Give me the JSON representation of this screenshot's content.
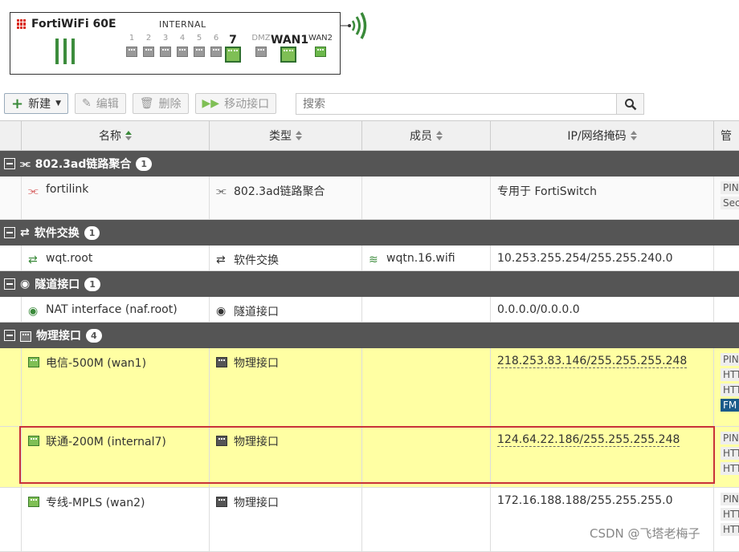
{
  "device": {
    "name": "FortiWiFi 60E",
    "internal_label": "INTERNAL",
    "ports": [
      "1",
      "2",
      "3",
      "4",
      "5",
      "6",
      "7"
    ],
    "dmz": "DMZ",
    "wan1": "WAN1",
    "wan2": "WAN2"
  },
  "toolbar": {
    "new_label": "新建",
    "edit_label": "编辑",
    "delete_label": "删除",
    "move_label": "移动接口"
  },
  "search": {
    "placeholder": "搜索"
  },
  "columns": {
    "name": "名称",
    "type": "类型",
    "members": "成员",
    "ip": "IP/网络掩码",
    "admin": "管"
  },
  "groups": [
    {
      "label": "802.3ad链路聚合",
      "count": "1"
    },
    {
      "label": "软件交换",
      "count": "1"
    },
    {
      "label": "隧道接口",
      "count": "1"
    },
    {
      "label": "物理接口",
      "count": "4"
    }
  ],
  "rows": [
    {
      "name": "fortilink",
      "type": "802.3ad链路聚合",
      "member": "",
      "ip": "专用于 FortiSwitch",
      "access": [
        "PIN",
        "Sec"
      ]
    },
    {
      "name": "wqt.root",
      "type": "软件交换",
      "member": "wqtn.16.wifi",
      "ip": "10.253.255.254/255.255.240.0",
      "access": []
    },
    {
      "name": "NAT interface (naf.root)",
      "type": "隧道接口",
      "member": "",
      "ip": "0.0.0.0/0.0.0.0",
      "access": []
    },
    {
      "name": "电信-500M (wan1)",
      "type": "物理接口",
      "member": "",
      "ip": "218.253.83.146/255.255.255.248",
      "access": [
        "PIN",
        "HTT",
        "HTT",
        "FM"
      ]
    },
    {
      "name": "联通-200M (internal7)",
      "type": "物理接口",
      "member": "",
      "ip": "124.64.22.186/255.255.255.248",
      "access": [
        "PIN",
        "HTT",
        "HTT"
      ]
    },
    {
      "name": "专线-MPLS (wan2)",
      "type": "物理接口",
      "member": "",
      "ip": "172.16.188.188/255.255.255.0",
      "access": [
        "PIN",
        "HTT",
        "HTT"
      ]
    }
  ],
  "watermark": "CSDN @飞塔老梅子",
  "colors": {
    "group_bar": "#555555",
    "selected_row": "#ffffa3",
    "highlight_box": "#c8313a",
    "fortinet_red": "#da291c"
  }
}
